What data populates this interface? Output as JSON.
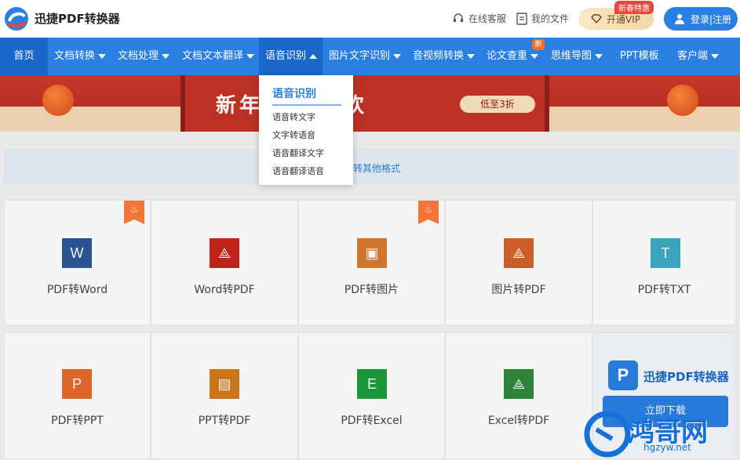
{
  "header": {
    "brand": "迅捷PDF转换器",
    "service_label": "在线客服",
    "files_label": "我的文件",
    "vip_label": "开通VIP",
    "vip_tag": "新春特惠",
    "login_label": "登录|注册"
  },
  "nav": {
    "items": [
      {
        "label": "首页"
      },
      {
        "label": "文档转换"
      },
      {
        "label": "文档处理"
      },
      {
        "label": "文档文本翻译"
      },
      {
        "label": "语音识别"
      },
      {
        "label": "图片文字识别"
      },
      {
        "label": "音视频转换"
      },
      {
        "label": "论文查重"
      },
      {
        "label": "思维导图"
      },
      {
        "label": "PPT模板"
      },
      {
        "label": "客户端"
      }
    ],
    "new_badge": "新"
  },
  "banner": {
    "text": "新年 限时狂欢",
    "sale": "低至3折"
  },
  "strip_text": "转其他格式",
  "dropdown": {
    "title": "语音识别",
    "items": [
      "语音转文字",
      "文字转语音",
      "语音翻译文字",
      "语音翻译语音"
    ]
  },
  "cards": [
    {
      "label": "PDF转Word",
      "icon": "W",
      "color": "#2b5797"
    },
    {
      "label": "Word转PDF",
      "icon": "pdf-icon",
      "color": "#c9251c"
    },
    {
      "label": "PDF转图片",
      "icon": "image-icon",
      "color": "#d97a2e"
    },
    {
      "label": "图片转PDF",
      "icon": "pdf-icon",
      "color": "#d4622a"
    },
    {
      "label": "PDF转TXT",
      "icon": "T",
      "color": "#3cabc4"
    },
    {
      "label": "PDF转PPT",
      "icon": "P",
      "color": "#e86b2d"
    },
    {
      "label": "PPT转PDF",
      "icon": "ppt-pdf-icon",
      "color": "#d47a1d"
    },
    {
      "label": "PDF转Excel",
      "icon": "E",
      "color": "#1e9e3a"
    },
    {
      "label": "Excel转PDF",
      "icon": "pdf-icon",
      "color": "#2f8a3c"
    }
  ],
  "promo": {
    "title": "迅捷PDF转换器",
    "button": "立即下载"
  },
  "watermark": {
    "text": "鸿哥网",
    "url": "hgzyw.net"
  }
}
